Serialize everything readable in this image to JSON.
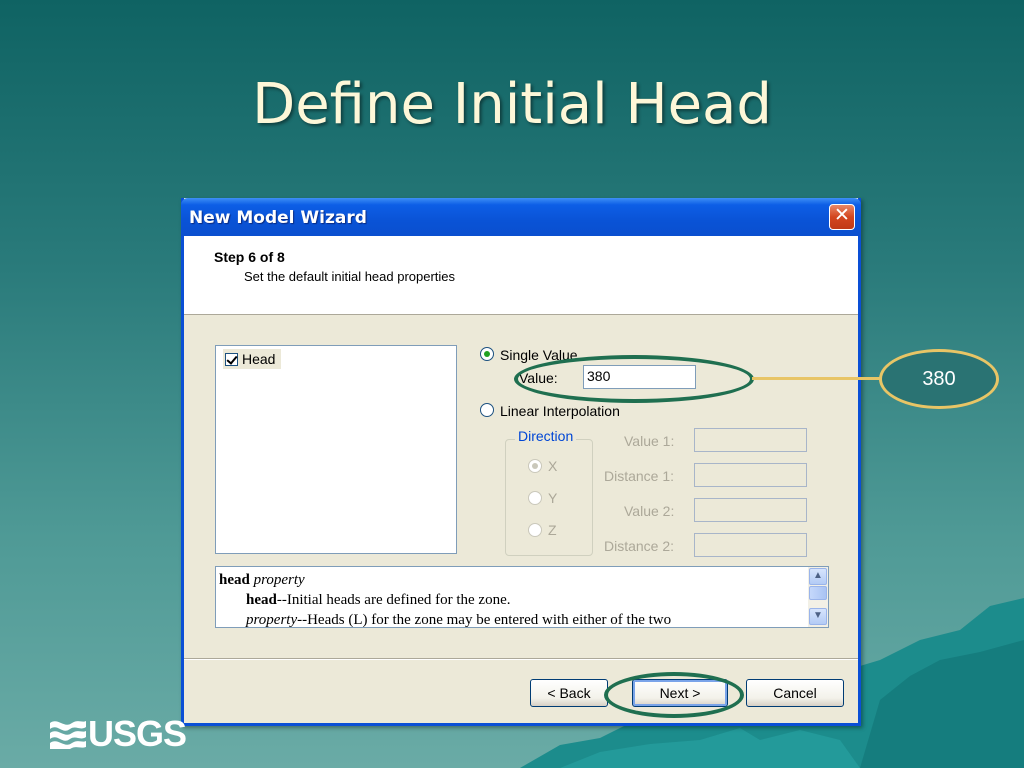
{
  "slide": {
    "title": "Define Initial Head"
  },
  "dialog": {
    "title": "New Model Wizard",
    "step": "Step 6 of 8",
    "subtitle": "Set the default initial head properties",
    "list": [
      {
        "label": "Head",
        "checked": true
      }
    ],
    "single_value": {
      "label": "Single Value",
      "selected": true,
      "value_label": "Value:",
      "value": "380"
    },
    "linear_interpolation": {
      "label": "Linear Interpolation",
      "selected": false
    },
    "direction": {
      "legend": "Direction",
      "options": [
        "X",
        "Y",
        "Z"
      ],
      "selected": "X"
    },
    "fields": {
      "value1_label": "Value 1:",
      "distance1_label": "Distance 1:",
      "value2_label": "Value 2:",
      "distance2_label": "Distance 2:"
    },
    "help": {
      "line1_bold": "head",
      "line1_italic": "property",
      "line2_bold": "head",
      "line2_text": "--Initial heads are defined for the zone.",
      "line3_italic": "property",
      "line3_text": "--Heads (L) for the zone may be entered with either of the two"
    },
    "buttons": {
      "back": "< Back",
      "next": "Next >",
      "cancel": "Cancel"
    }
  },
  "callout": {
    "text": "380"
  },
  "logo": {
    "text": "USGS"
  },
  "colors": {
    "accent_ellipse": "#1f6f50",
    "callout": "#e8c566",
    "titlebar": "#0a53d6"
  }
}
